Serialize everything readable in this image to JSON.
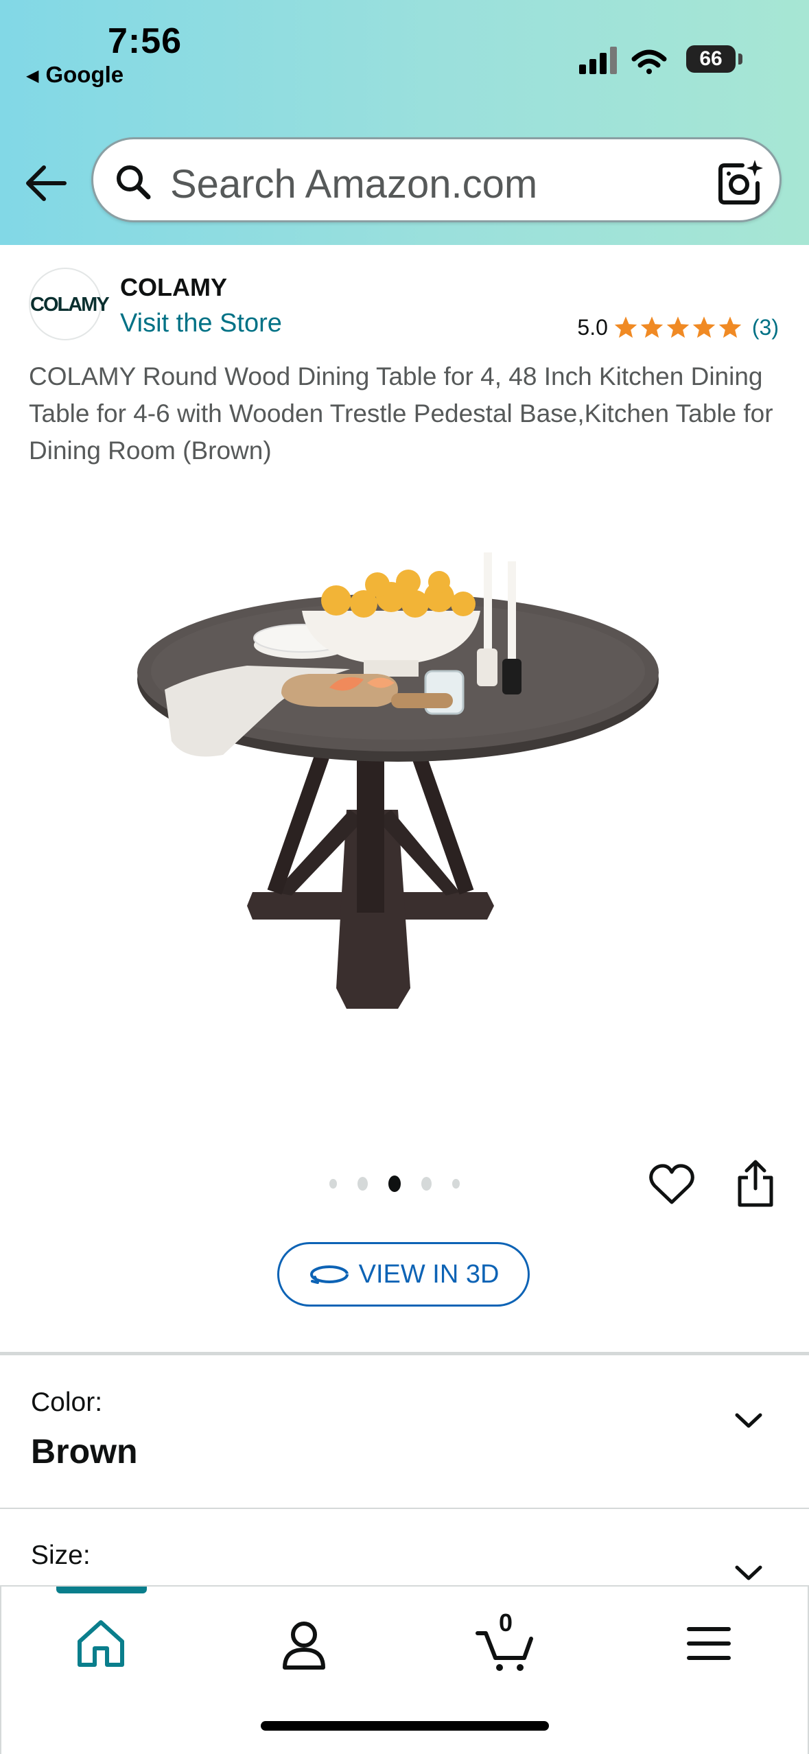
{
  "status_bar": {
    "time": "7:56",
    "back_app": "Google",
    "battery": "66",
    "icons": [
      "cellular-signal-icon",
      "wifi-icon",
      "battery-icon"
    ]
  },
  "header": {
    "search_placeholder": "Search Amazon.com",
    "icons": [
      "back-arrow-icon",
      "search-icon",
      "camera-icon"
    ]
  },
  "brand": {
    "logo_text": "COLAMY",
    "name": "COLAMY",
    "visit_store": "Visit the Store",
    "rating": "5.0",
    "stars": 5,
    "review_count": "(3)"
  },
  "product": {
    "title": "COLAMY Round Wood Dining Table for 4, 48 Inch Kitchen Dining Table for 4-6 with Wooden Trestle Pedestal Base,Kitchen Table for Dining Room (Brown)",
    "image_count": 5,
    "active_image": 3,
    "view_3d_label": "VIEW IN 3D"
  },
  "options": {
    "color_label": "Color:",
    "color_value": "Brown",
    "size_label": "Size:"
  },
  "bottom_nav": {
    "items": [
      "home",
      "account",
      "cart",
      "menu"
    ],
    "active": "home",
    "cart_count": "0"
  },
  "colors": {
    "link": "#007185",
    "star": "#f08a24",
    "button_blue": "#0d63b5",
    "nav_active": "#0a7e8c"
  }
}
